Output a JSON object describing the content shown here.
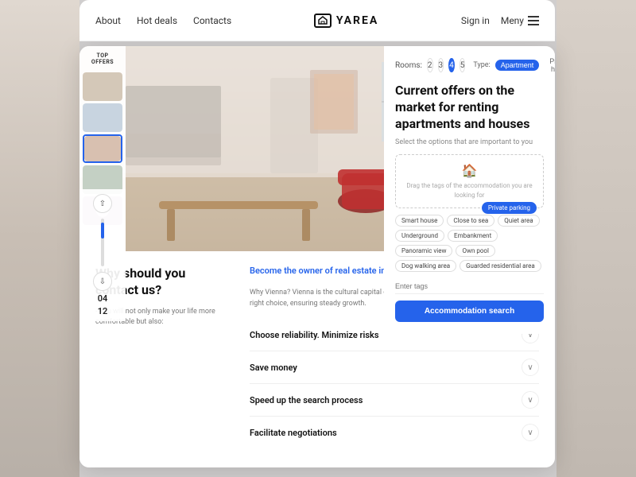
{
  "navbar": {
    "links": [
      {
        "label": "About",
        "id": "about"
      },
      {
        "label": "Hot deals",
        "id": "hot-deals"
      },
      {
        "label": "Contacts",
        "id": "contacts"
      }
    ],
    "logo_text": "YAREA",
    "sign_in": "Sign in",
    "meny": "Meny"
  },
  "hero": {
    "top_offers_label": "TOP\nOFFERS"
  },
  "right_panel": {
    "rooms_label": "Rooms:",
    "room_numbers": [
      "2",
      "3",
      "4",
      "5"
    ],
    "active_room": "4",
    "type_label": "Type:",
    "types": [
      "Apartment",
      "Private house"
    ],
    "active_type": "Apartment",
    "title": "Current offers on the market for renting apartments and houses",
    "subtitle": "Select the options that are important to you",
    "drop_zone_text": "Drag the tags of the accommodation you are looking for",
    "private_parking_badge": "Private parking",
    "tags": [
      "Smart house",
      "Close to sea",
      "Quiet area",
      "Underground",
      "Embankment",
      "Panoramic view",
      "Own pool",
      "Dog walking area",
      "Guarded residential area"
    ],
    "tag_input_placeholder": "Enter tags",
    "search_button": "Accommodation search"
  },
  "bottom": {
    "left": {
      "heading": "Why should you\ncontact us?",
      "text": "- You will not only make your life more comfortable but also:"
    },
    "right": {
      "vienna_title": "Become the owner of real estate in Vienna",
      "vienna_text": "Why Vienna? Vienna is the cultural capital of Europe! Investing in real estate here is the right choice, ensuring steady growth.",
      "accordion_items": [
        {
          "label": "Choose reliability. Minimize risks",
          "id": "reliability"
        },
        {
          "label": "Save money",
          "id": "save-money"
        },
        {
          "label": "Speed up the search process",
          "id": "speed-up"
        },
        {
          "label": "Facilitate negotiations",
          "id": "facilitate"
        }
      ]
    }
  },
  "slider": {
    "top_number": "04",
    "bottom_number": "12"
  },
  "thumbs": [
    {
      "color": "#d4c8b8"
    },
    {
      "color": "#c8d4e0"
    },
    {
      "color": "#d8c0b0"
    },
    {
      "color": "#c4d0c4"
    },
    {
      "color": "#d0c0d0",
      "has_play": true
    }
  ]
}
